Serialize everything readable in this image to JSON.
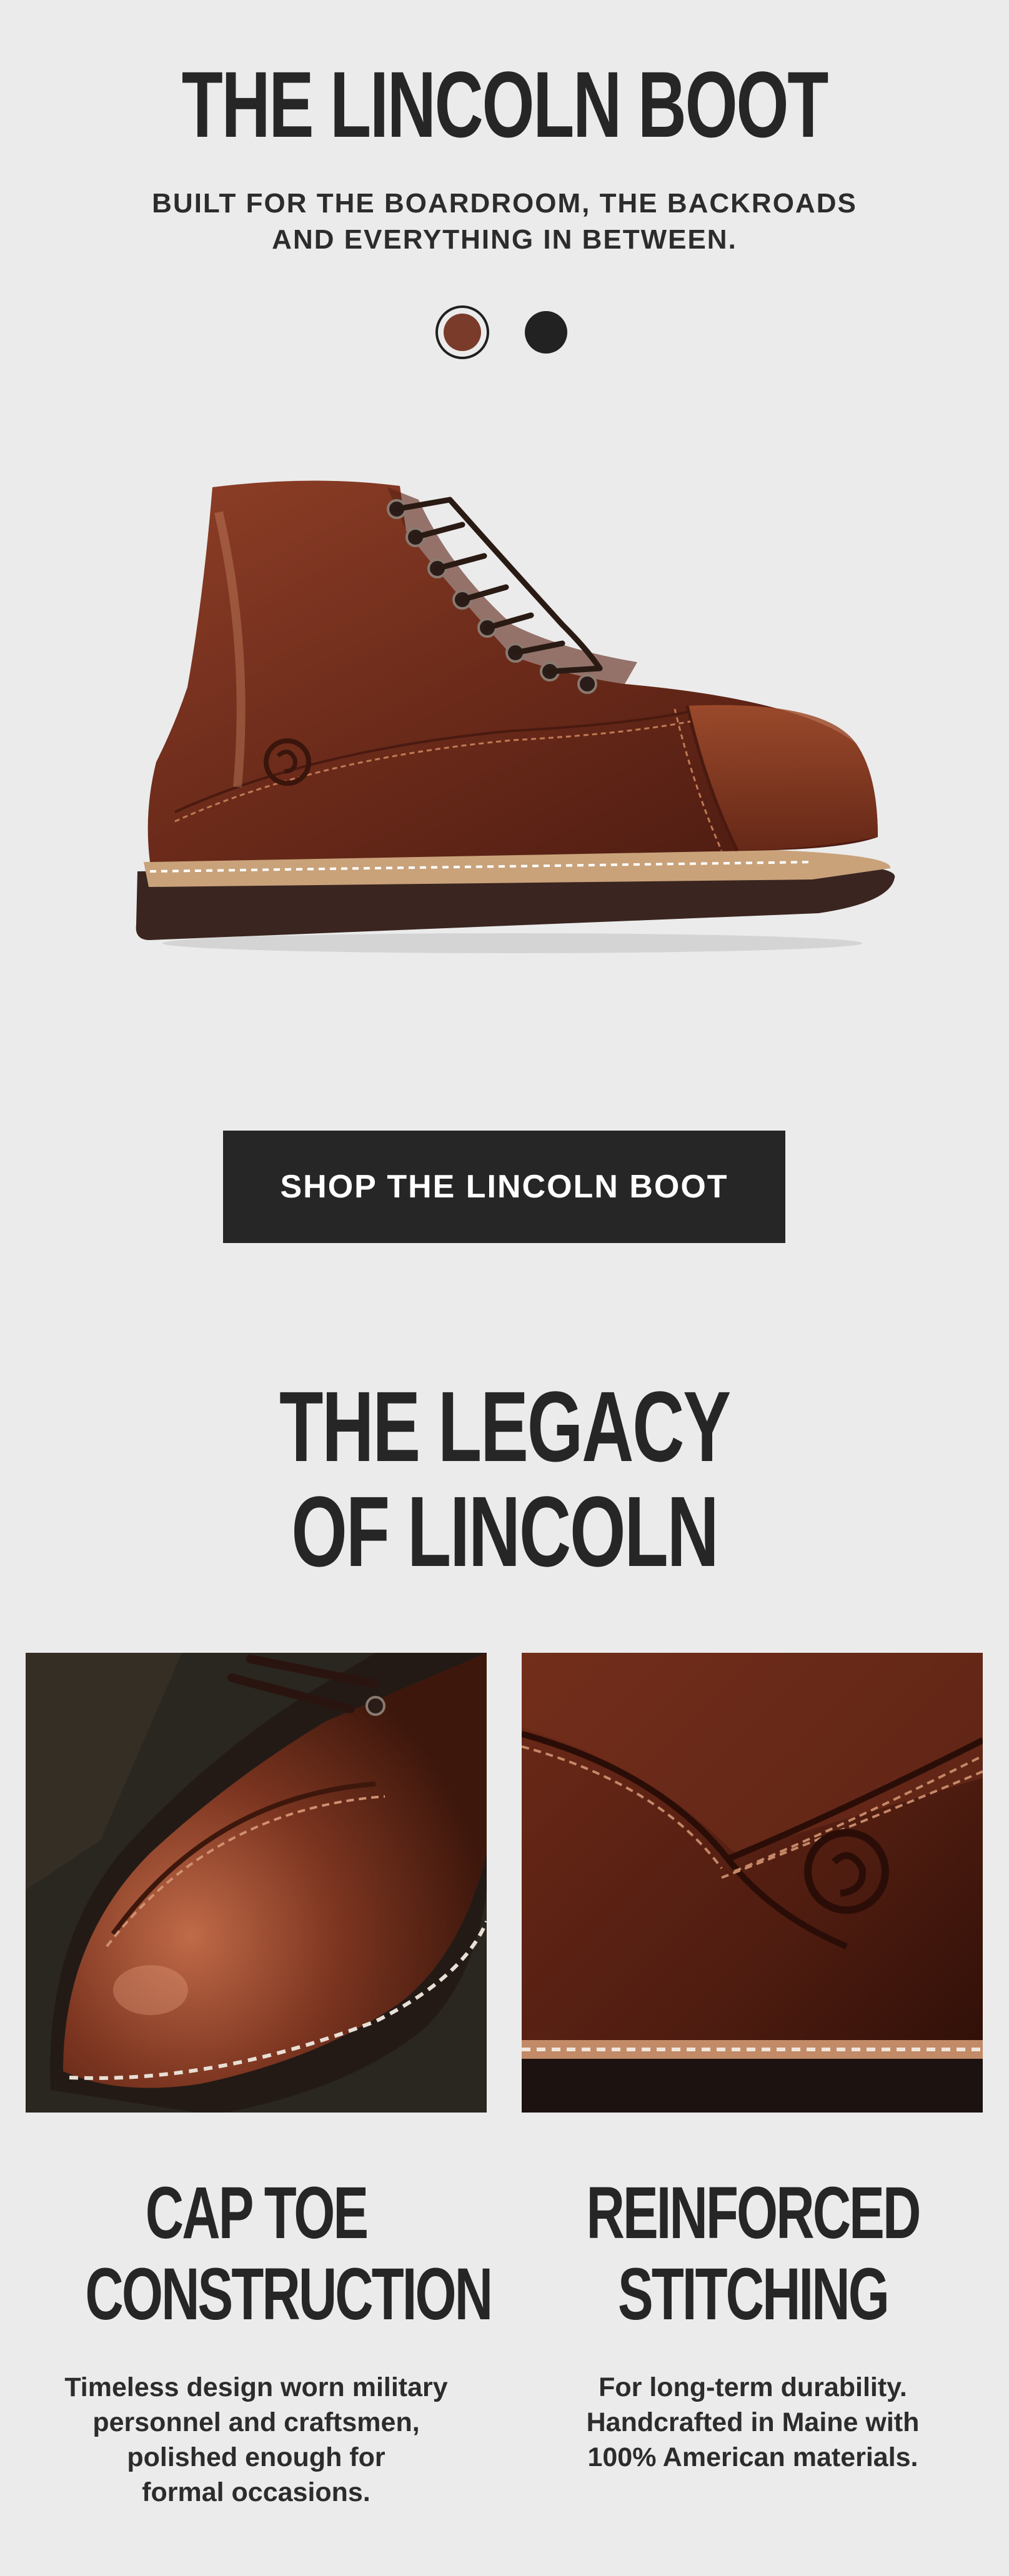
{
  "header": {
    "title": "THE LINCOLN BOOT",
    "subtitle_line1": "BUILT FOR THE BOARDROOM, THE BACKROADS",
    "subtitle_line2": "AND EVERYTHING IN BETWEEN."
  },
  "swatches": [
    {
      "color": "#7a3b2a",
      "name": "brown",
      "selected": true
    },
    {
      "color": "#222222",
      "name": "black",
      "selected": false
    }
  ],
  "cta": {
    "label": "SHOP THE LINCOLN BOOT"
  },
  "legacy": {
    "line1": "THE LEGACY",
    "line2": "OF LINCOLN"
  },
  "features": [
    {
      "title_line1": "CAP TOE",
      "title_line2": "CONSTRUCTION",
      "body": [
        "Timeless design worn military",
        "personnel and craftsmen,",
        "polished enough for",
        "formal occasions."
      ]
    },
    {
      "title_line1": "REINFORCED",
      "title_line2": "STITCHING",
      "body": [
        "For long-term durability.",
        "Handcrafted in Maine with",
        "100% American materials."
      ]
    }
  ]
}
